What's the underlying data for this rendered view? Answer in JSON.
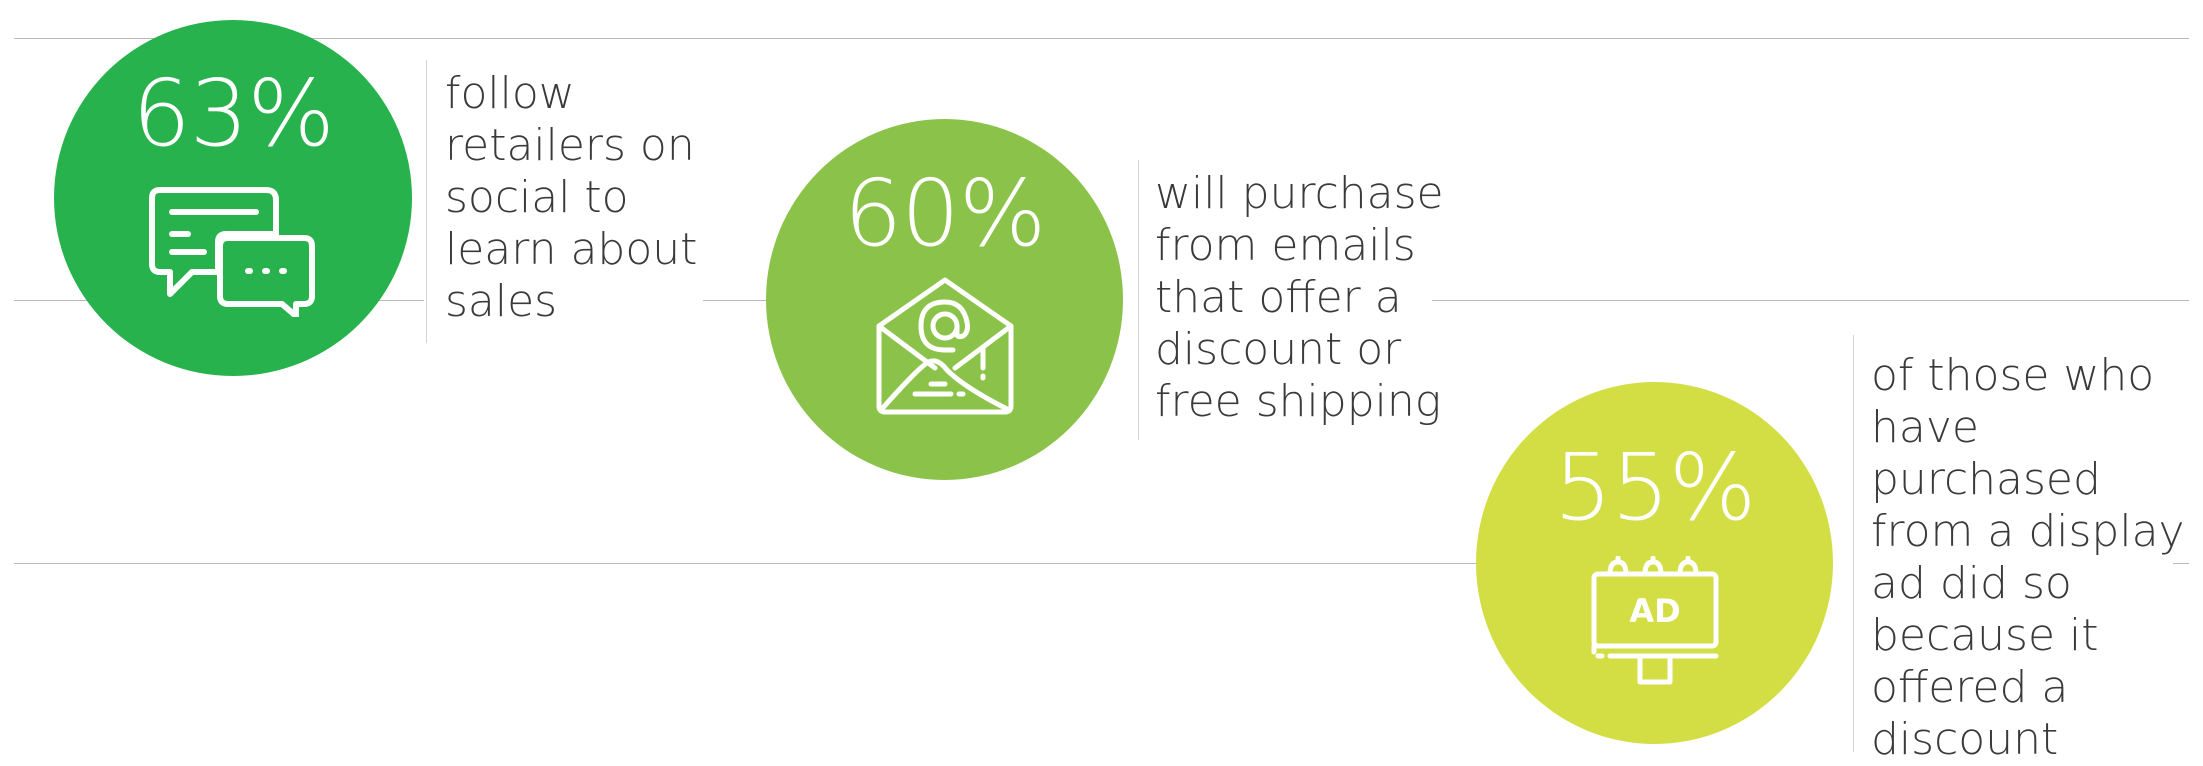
{
  "stats": [
    {
      "percent": "63%",
      "text": "follow\nretailers on\nsocial to\nlearn about\nsales",
      "color": "#27b24d",
      "icon": "chat-bubbles-icon"
    },
    {
      "percent": "60%",
      "text": "will purchase\nfrom emails\nthat offer a\ndiscount or\nfree shipping",
      "color": "#8bc34a",
      "icon": "envelope-at-icon"
    },
    {
      "percent": "55%",
      "text": "of those who\nhave\npurchased\nfrom a display\nad did so\nbecause it\noffered a\ndiscount",
      "color": "#d3de45",
      "icon": "billboard-ad-icon",
      "icon_text": "AD"
    }
  ]
}
